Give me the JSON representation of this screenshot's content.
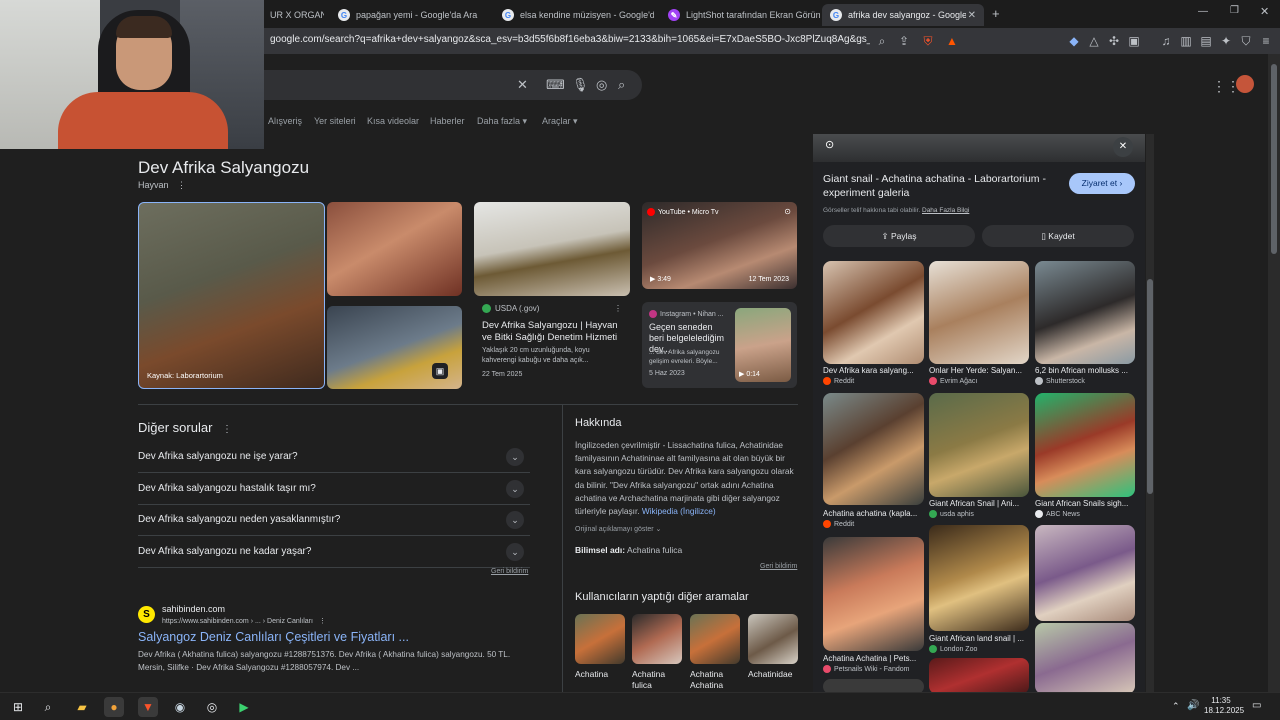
{
  "tabs": [
    {
      "title": "UR X ORGANI"
    },
    {
      "title": "papağan yemi - Google'da Ara"
    },
    {
      "title": "elsa kendine müzisyen - Google'da A"
    },
    {
      "title": "LightShot tarafından Ekran Görüntü"
    },
    {
      "title": "afrika dev salyangoz - Google'da"
    }
  ],
  "url": "google.com/search?q=afrika+dev+salyangoz&sca_esv=b3d55f6b8f16eba3&biw=2133&bih=1065&ei=E7xDaeS5BO-Jxc8PlZuq8Ag&gs_ssp=eJ...",
  "filters": [
    "Alışveriş",
    "Yer siteleri",
    "Kısa videolar",
    "Haberler",
    "Daha fazla",
    "Araçlar"
  ],
  "knowledge": {
    "title": "Dev Afrika Salyangozu",
    "subtitle": "Hayvan",
    "main_img_caption": "Kaynak: Laborartorium",
    "card1": {
      "source": "USDA (.gov)",
      "title": "Dev Afrika Salyangozu | Hayvan ve Bitki Sağlığı Denetim Hizmeti",
      "desc": "Yaklaşık 20 cm uzunluğunda, koyu kahverengi kabuğu ve daha açık...",
      "date": "22 Tem 2025"
    },
    "card2": {
      "source": "YouTube • Micro Tv",
      "duration": "3:49",
      "date": "12 Tem 2023"
    },
    "card3": {
      "source": "Instagram • Nihan ...",
      "title": "Geçen seneden beri belgelelediğim dev...",
      "desc": "... dev Afrika salyangozu gelişim evreleri. Böyle...",
      "date": "5 Haz 2023",
      "duration": "0:14"
    }
  },
  "questions": {
    "heading": "Diğer sorular",
    "items": [
      "Dev Afrika salyangozu ne işe yarar?",
      "Dev Afrika salyangozu hastalık taşır mı?",
      "Dev Afrika salyangozu neden yasaklanmıştır?",
      "Dev Afrika salyangozu ne kadar yaşar?"
    ],
    "feedback": "Geri bildirim"
  },
  "about": {
    "heading": "Hakkında",
    "text": "İngilizceden çevrilmiştir - Lissachatina fulica, Achatinidae familyasının Achatininae alt familyasına ait olan büyük bir kara salyangozu türüdür. Dev Afrika kara salyangozu olarak da bilinir. \"Dev Afrika salyangozu\" ortak adını Achatina achatina ve Archachatina marjinata gibi diğer salyangoz türleriyle paylaşır.",
    "link": "Wikipedia (İngilizce)",
    "show_original": "Orijinal açıklamayı göster",
    "sci_label": "Bilimsel adı:",
    "sci_value": "Achatina fulica",
    "feedback": "Geri bildirim"
  },
  "related": {
    "heading": "Kullanıcıların yaptığı diğer aramalar",
    "items": [
      "Achatina",
      "Achatina fulica",
      "Achatina Achatina",
      "Achatinidae"
    ]
  },
  "result": {
    "site": "sahibinden.com",
    "url": "https://www.sahibinden.com › ... › Deniz Canlıları",
    "title": "Salyangoz Deniz Canlıları Çeşitleri ve Fiyatları ...",
    "snippet": "Dev Afrika ( Akhatina fulica) salyangozu #1288751376. Dev Afrika ( Akhatina fulica) salyangozu. 50 TL. Mersin, Silifke · Dev Afrika Salyangozu #1288057974. Dev ..."
  },
  "panel": {
    "title": "Giant snail - Achatina achatina - Laborartorium - experiment galeria",
    "visit": "Ziyaret et",
    "rights": "Görseller telif hakkına tabi olabilir.",
    "more_info": "Daha Fazla Bilgi",
    "share": "Paylaş",
    "save": "Kaydet",
    "images": [
      {
        "caption": "Dev Afrika kara salyang...",
        "source": "Reddit"
      },
      {
        "caption": "Onlar Her Yerde: Salyan...",
        "source": "Evrim Ağacı"
      },
      {
        "caption": "6,2 bin African mollusks ...",
        "source": "Shutterstock"
      },
      {
        "caption": "Achatina achatina (kapla...",
        "source": "Reddit"
      },
      {
        "caption": "Giant African Snail | Ani...",
        "source": "usda aphis"
      },
      {
        "caption": "Giant African Snails sigh...",
        "source": "ABC News"
      },
      {
        "caption": "Achatina Achatina | Pets...",
        "source": "Petsnails Wiki - Fandom"
      },
      {
        "caption": "Giant African land snail | ...",
        "source": "London Zoo"
      }
    ]
  },
  "clock": {
    "time": "11:35",
    "date": "18.12.2025"
  }
}
